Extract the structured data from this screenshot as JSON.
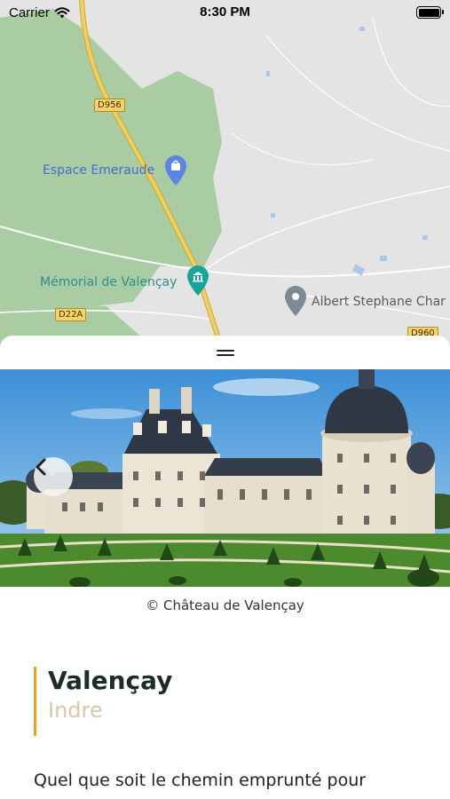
{
  "status_bar": {
    "carrier": "Carrier",
    "time": "8:30 PM"
  },
  "map": {
    "roads": [
      "D956",
      "D22A",
      "D960"
    ],
    "places": [
      {
        "name": "Espace Emeraude",
        "icon": "shopping-bag-icon"
      },
      {
        "name": "Mémorial de Valençay",
        "icon": "monument-icon"
      },
      {
        "name": "Albert Stephane Char",
        "icon": "location-pin-icon"
      }
    ],
    "colors": {
      "land": "#e4e4e4",
      "forest": "#a9cca3",
      "main_road": "#f2cf5c",
      "water": "#a9c7ea"
    }
  },
  "sheet": {
    "photo_alt": "Château de Valençay",
    "credit": "© Château de Valençay",
    "title": "Valençay",
    "subtitle": "Indre",
    "body": "Quel que soit le chemin emprunté pour",
    "accent_color": "#f0a01a",
    "back_icon": "chevron-left-icon",
    "handle_icon": "drag-handle-icon"
  }
}
